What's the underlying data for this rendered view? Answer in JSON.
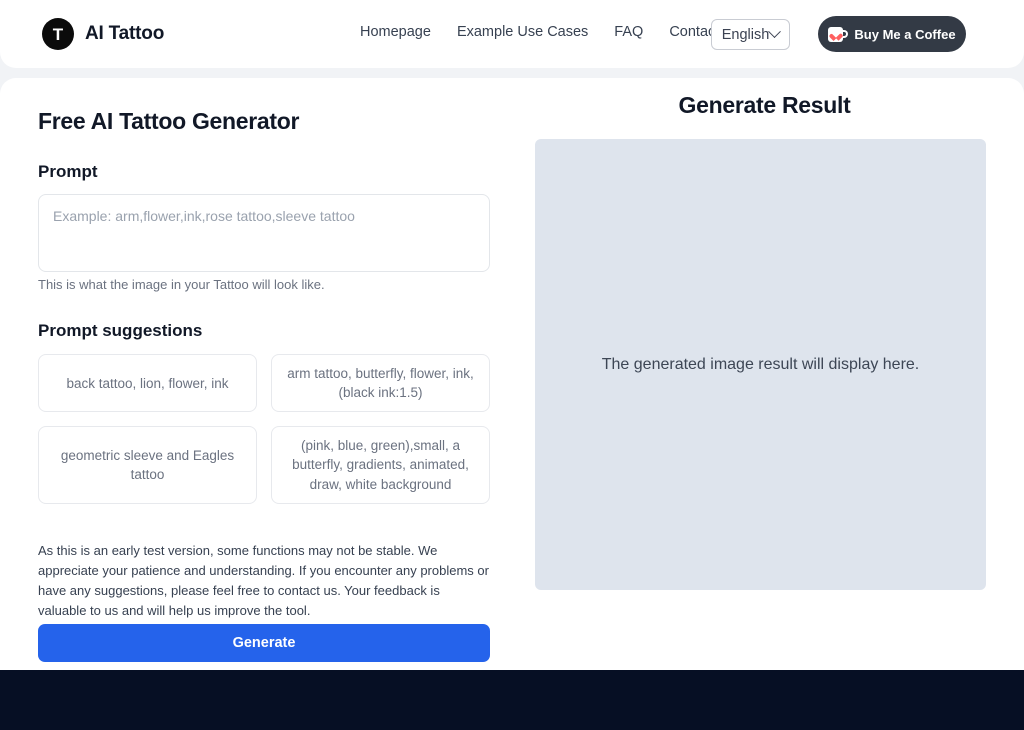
{
  "header": {
    "logo_letter": "T",
    "brand": "AI Tattoo",
    "nav": [
      {
        "label": "Homepage"
      },
      {
        "label": "Example Use Cases"
      },
      {
        "label": "FAQ"
      },
      {
        "label": "Contact"
      }
    ],
    "language": {
      "selected": "English",
      "icon": "chevron-down-icon"
    },
    "coffee_button": {
      "label": "Buy Me a Coffee",
      "icon": "coffee-cup-heart-icon",
      "bg_color": "#333a45",
      "heart_color": "#ff5f5f"
    }
  },
  "main": {
    "title": "Free AI Tattoo Generator",
    "prompt": {
      "label": "Prompt",
      "value": "",
      "placeholder": "Example: arm,flower,ink,rose tattoo,sleeve tattoo",
      "help": "This is what the image in your Tattoo will look like."
    },
    "suggestions": {
      "label": "Prompt suggestions",
      "items": [
        {
          "text": "back tattoo, lion, flower, ink"
        },
        {
          "text": "arm tattoo, butterfly, flower, ink, (black ink:1.5)"
        },
        {
          "text": "geometric sleeve and Eagles tattoo"
        },
        {
          "text": "(pink, blue, green),small, a butterfly, gradients, animated, draw, white background"
        }
      ]
    },
    "disclaimer": "As this is an early test version, some functions may not be stable. We appreciate your patience and understanding. If you encounter any problems or have any suggestions, please feel free to contact us. Your feedback is valuable to us and will help us improve the tool.",
    "generate_button": {
      "label": "Generate",
      "color": "#2563eb"
    }
  },
  "result": {
    "title": "Generate Result",
    "placeholder": "The generated image result will display here.",
    "panel_color": "#dee4ed"
  },
  "footer": {
    "bg_color": "#060f24"
  }
}
